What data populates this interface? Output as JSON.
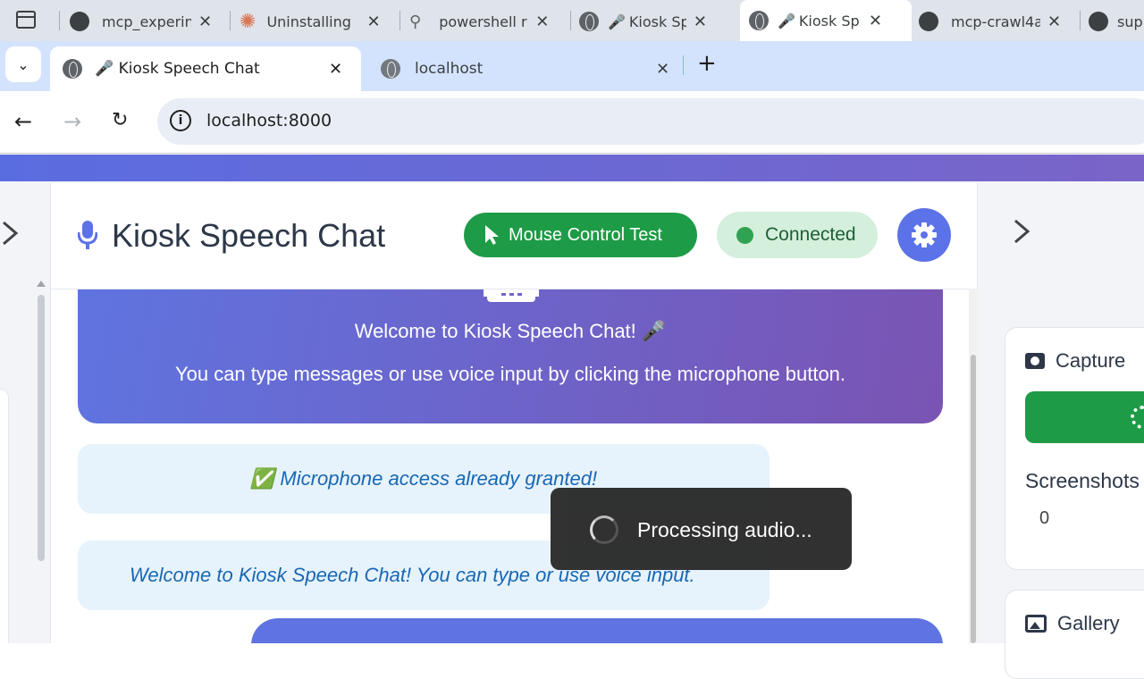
{
  "window_tabs": [
    {
      "title": "mcp_experin"
    },
    {
      "title": "Uninstalling"
    },
    {
      "title": "powershell r"
    },
    {
      "title": "Kiosk Sp"
    },
    {
      "title": "Kiosk Sp"
    },
    {
      "title": "mcp-crawl4a"
    },
    {
      "title": "sup"
    }
  ],
  "browser_tabs": [
    {
      "title": "🎤 Kiosk Speech Chat",
      "active": true
    },
    {
      "title": "localhost",
      "active": false
    }
  ],
  "address_bar": {
    "url": "localhost:8000"
  },
  "header": {
    "title": "Kiosk Speech Chat",
    "mouse_button_label": "Mouse Control Test",
    "status_label": "Connected"
  },
  "chat": {
    "welcome_line1": "Welcome to Kiosk Speech Chat! 🎤",
    "welcome_line2": "You can type messages or use voice input by clicking the microphone button.",
    "system_message_1": "✅ Microphone access already granted!",
    "system_message_2": "Welcome to Kiosk Speech Chat! You can type or use voice input."
  },
  "toast": {
    "label": "Processing audio..."
  },
  "right_panel": {
    "capture_title": "Capture",
    "screenshots_label": "Screenshots",
    "screenshots_count": "0",
    "gallery_title": "Gallery"
  },
  "colors": {
    "accent": "#5b72e8",
    "success": "#1e9b46",
    "connected_bg": "#d4efdc"
  }
}
